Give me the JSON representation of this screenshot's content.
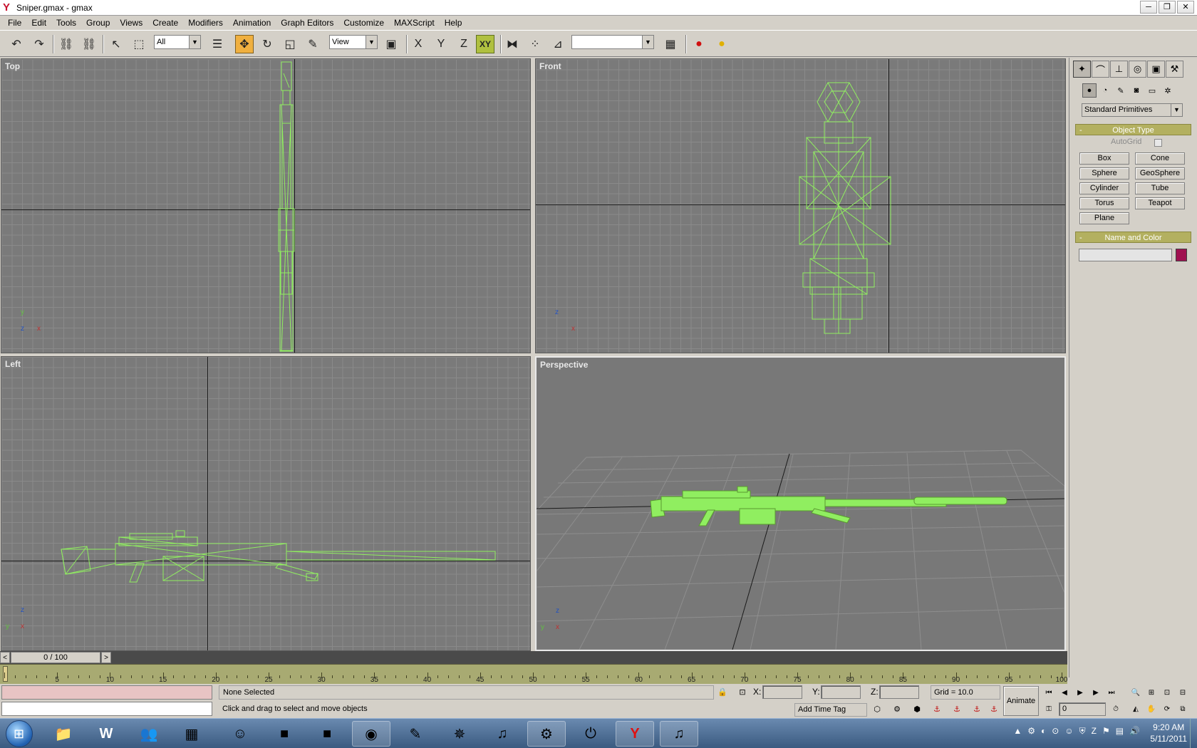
{
  "window": {
    "title": "Sniper.gmax - gmax"
  },
  "menu": [
    "File",
    "Edit",
    "Tools",
    "Group",
    "Views",
    "Create",
    "Modifiers",
    "Animation",
    "Graph Editors",
    "Customize",
    "MAXScript",
    "Help"
  ],
  "toolbar": {
    "selection_filter": "All",
    "coord_system": "View",
    "axis_x": "X",
    "axis_y": "Y",
    "axis_z": "Z",
    "axis_xy": "XY",
    "named_selection": ""
  },
  "viewports": {
    "top": {
      "label": "Top"
    },
    "front": {
      "label": "Front"
    },
    "left": {
      "label": "Left"
    },
    "perspective": {
      "label": "Perspective"
    }
  },
  "command_panel": {
    "category": "Standard Primitives",
    "object_type_title": "Object Type",
    "autogrid_label": "AutoGrid",
    "primitives": [
      "Box",
      "Cone",
      "Sphere",
      "GeoSphere",
      "Cylinder",
      "Tube",
      "Torus",
      "Teapot",
      "Plane"
    ],
    "name_color_title": "Name and Color",
    "object_name": "",
    "object_color": "#a01050"
  },
  "timeline": {
    "frame_display": "0 / 100",
    "ticks": [
      "5",
      "10",
      "15",
      "20",
      "25",
      "30",
      "35",
      "40",
      "45",
      "50",
      "55",
      "60",
      "65",
      "70",
      "75",
      "80",
      "85",
      "90",
      "95",
      "100"
    ]
  },
  "status": {
    "selection": "None Selected",
    "prompt": "Click and drag to select and move objects",
    "x_label": "X:",
    "y_label": "Y:",
    "z_label": "Z:",
    "x_value": "",
    "y_value": "",
    "z_value": "",
    "grid": "Grid = 10.0",
    "add_time_tag": "Add Time Tag",
    "animate": "Animate",
    "current_frame": "0"
  },
  "taskbar": {
    "time": "9:20 AM",
    "date": "5/11/2011"
  },
  "colors": {
    "wireframe": "#90ee60",
    "viewport_bg": "#7a7a7a",
    "active_tool": "#f0b040"
  }
}
